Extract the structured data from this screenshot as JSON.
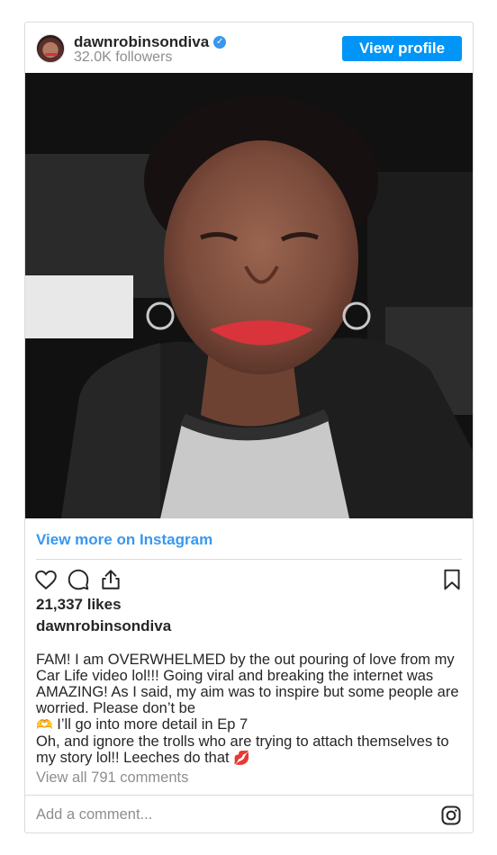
{
  "header": {
    "username": "dawnrobinsondiva",
    "verified_badge": "verified-icon",
    "followers": "32.0K followers",
    "view_profile_label": "View profile",
    "accent_color": "#0095f6"
  },
  "post": {
    "view_more_label": "View more on Instagram",
    "likes": "21,337 likes",
    "author": "dawnrobinsondiva",
    "caption_line1": "FAM! I am OVERWHELMED by the out pouring of love from my Car Life video lol!!! Going viral and breaking the internet was AMAZING! As I said, my aim was to inspire but some people are worried. Please don’t be",
    "caption_line2_emoji": "🫶",
    "caption_line2": " I’ll go into more detail in Ep 7",
    "caption_line3": "Oh, and ignore the trolls who are trying to attach themselves to my story lol!! Leeches do that ",
    "caption_line3_emoji": "💋",
    "view_comments": "View all 791 comments"
  },
  "icons": {
    "like": "heart-icon",
    "comment": "comment-icon",
    "share": "share-icon",
    "save": "bookmark-icon",
    "brand": "instagram-icon"
  },
  "comment_box": {
    "placeholder": "Add a comment..."
  }
}
